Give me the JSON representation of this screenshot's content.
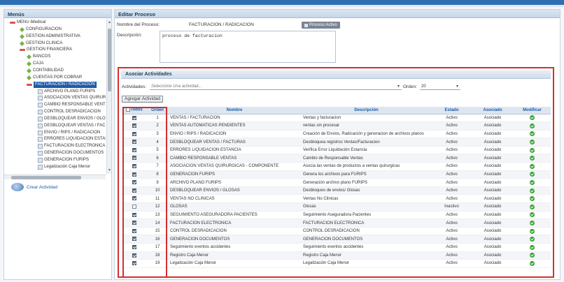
{
  "menu": {
    "title": "Menús",
    "tree": [
      {
        "label": "MENU iMedical",
        "icon": "minus",
        "level": 0
      },
      {
        "label": "CONFIGURACION",
        "icon": "diamond",
        "level": 1
      },
      {
        "label": "GESTION ADMINISTRATIVA",
        "icon": "diamond",
        "level": 1
      },
      {
        "label": "GESTION CLINICA",
        "icon": "diamond",
        "level": 1
      },
      {
        "label": "GESTION FINANCIERA",
        "icon": "minus",
        "level": 1
      },
      {
        "label": "BANCOS",
        "icon": "diamond",
        "level": 2
      },
      {
        "label": "CAJA",
        "icon": "diamond",
        "level": 2
      },
      {
        "label": "CONTABILIDAD",
        "icon": "diamond",
        "level": 2
      },
      {
        "label": "CUENTAS POR COBRAR",
        "icon": "diamond",
        "level": 2
      },
      {
        "label": "FACTURACION / RADICACION",
        "icon": "minus",
        "level": 2,
        "selected": true
      },
      {
        "label": "ARCHIVO PLANO FURIPS",
        "icon": "doc",
        "level": 3
      },
      {
        "label": "ASOCIACION VENTAS QUIRUR",
        "icon": "doc",
        "level": 3
      },
      {
        "label": "CAMBIO RESPONSABLE VENT",
        "icon": "doc",
        "level": 3
      },
      {
        "label": "CONTROL DESRADICACION",
        "icon": "doc",
        "level": 3
      },
      {
        "label": "DESBLOQUEAR ENVIOS / GLO",
        "icon": "doc",
        "level": 3
      },
      {
        "label": "DESBLOQUEAR VENTAS / FAC",
        "icon": "doc",
        "level": 3
      },
      {
        "label": "ENVIO / RIPS / RADICACION",
        "icon": "doc",
        "level": 3
      },
      {
        "label": "ERRORES LIQUIDACION ESTAI",
        "icon": "doc",
        "level": 3
      },
      {
        "label": "FACTURACION ELECTRONICA",
        "icon": "doc",
        "level": 3
      },
      {
        "label": "GENERACION DOCUMENTOS",
        "icon": "doc",
        "level": 3
      },
      {
        "label": "GENERACION FURIPS",
        "icon": "doc",
        "level": 3
      },
      {
        "label": "Legalización Caja Menor",
        "icon": "doc",
        "level": 3
      }
    ],
    "crear_actividad": "Crear Actividad"
  },
  "edit": {
    "title": "Editar Proceso",
    "nombre_label": "Nombre del Proceso:",
    "nombre_value": "FACTURACION / RADICACION",
    "activo_button": "Proceso Activo",
    "descripcion_label": "Descripción:",
    "descripcion_value": "proceso de facturacion"
  },
  "asociar": {
    "title": "Asociar Actividades",
    "actividades_label": "Actividades:",
    "actividades_placeholder": "Seleccione Una actividad...",
    "orden_label": "Orden:",
    "orden_value": "20",
    "agregar_button": "Agregar Actividad",
    "columns": {
      "todos": "Todos",
      "orden": "Orden",
      "nombre": "Nombre",
      "descripcion": "Descripción",
      "estado": "Estado",
      "asociado": "Asociado",
      "modificar": "Modificar"
    },
    "rows": [
      {
        "checked": true,
        "orden": "1",
        "nombre": "VENTAS / FACTURACION",
        "descripcion": "Ventas y facturacion",
        "estado": "Activo",
        "asociado": "Asociado"
      },
      {
        "checked": true,
        "orden": "2",
        "nombre": "VENTAS AUTOMATICAS PENDIENTES",
        "descripcion": "ventas sin procesar",
        "estado": "Activo",
        "asociado": "Asociado"
      },
      {
        "checked": true,
        "orden": "3",
        "nombre": "ENVIO / RIPS / RADICACION",
        "descripcion": "Creación de Envios, Radicación y generacion de archivos planos",
        "estado": "Activo",
        "asociado": "Asociado"
      },
      {
        "checked": true,
        "orden": "4",
        "nombre": "DESBLOQUEAR VENTAS / FACTURAS",
        "descripcion": "Desbloquea registros Ventas/Facturacion",
        "estado": "Activo",
        "asociado": "Asociado"
      },
      {
        "checked": true,
        "orden": "5",
        "nombre": "ERRORES LIQUIDACION ESTANCIA",
        "descripcion": "Verifica Error Liquidación Estancia",
        "estado": "Activo",
        "asociado": "Asociado"
      },
      {
        "checked": true,
        "orden": "6",
        "nombre": "CAMBIO RESPONSABLE VENTAS",
        "descripcion": "Cambio de Responsable Ventas",
        "estado": "Activo",
        "asociado": "Asociado"
      },
      {
        "checked": true,
        "orden": "7",
        "nombre": "ASOCIACION VENTAS QUIRURGICAS - COMPONENTE",
        "descripcion": "Asocia las ventas de productos a ventas quirurgicas",
        "estado": "Activo",
        "asociado": "Asociado"
      },
      {
        "checked": true,
        "orden": "8",
        "nombre": "GENERACION FURIPS",
        "descripcion": "Genera los archivos para FURIPS",
        "estado": "Activo",
        "asociado": "Asociado"
      },
      {
        "checked": true,
        "orden": "9",
        "nombre": "ARCHIVO PLANO FURIPS",
        "descripcion": "Generación archivo plano FURIPS",
        "estado": "Activo",
        "asociado": "Asociado"
      },
      {
        "checked": true,
        "orden": "10",
        "nombre": "DESBLOQUEAR ENVIOS / GLOSAS",
        "descripcion": "Desbloqueo de envios/ Glosas",
        "estado": "Activo",
        "asociado": "Asociado"
      },
      {
        "checked": true,
        "orden": "11",
        "nombre": "VENTAS NO CLINICAS",
        "descripcion": "Ventas No Clinicas",
        "estado": "Activo",
        "asociado": "Asociado"
      },
      {
        "checked": false,
        "orden": "12",
        "nombre": "GLOSAS",
        "descripcion": "Glosas",
        "estado": "Inactivo",
        "asociado": "Asociado"
      },
      {
        "checked": true,
        "orden": "13",
        "nombre": "SEGUIMIENTO ASEGURADORA PACIENTES",
        "descripcion": "Seguimiento Aseguradora Pacientes",
        "estado": "Activo",
        "asociado": "Asociado"
      },
      {
        "checked": true,
        "orden": "14",
        "nombre": "FACTURACION ELECTRONICA",
        "descripcion": "FACTURACION ELECTRONICA",
        "estado": "Activo",
        "asociado": "Asociado"
      },
      {
        "checked": true,
        "orden": "15",
        "nombre": "CONTROL DESRADICACION",
        "descripcion": "CONTROL DESRADICACION",
        "estado": "Activo",
        "asociado": "Asociado"
      },
      {
        "checked": true,
        "orden": "16",
        "nombre": "GENERACION DOCUMENTOS",
        "descripcion": "GENERACION DOCUMENTOS",
        "estado": "Activo",
        "asociado": "Asociado"
      },
      {
        "checked": true,
        "orden": "17",
        "nombre": "Seguimiento eventos accidentes",
        "descripcion": "Seguimiento eventos accidentes",
        "estado": "Activo",
        "asociado": "Asociado"
      },
      {
        "checked": true,
        "orden": "18",
        "nombre": "Registro Caja Menor",
        "descripcion": "Registro Caja Menor",
        "estado": "Activo",
        "asociado": "Asociado"
      },
      {
        "checked": true,
        "orden": "19",
        "nombre": "Legalización Caja Menor",
        "descripcion": "Legalización Caja Menor",
        "estado": "Activo",
        "asociado": "Asociado"
      }
    ],
    "modificar_icon": "check-circle-icon"
  },
  "colors": {
    "header_text": "#1e5aa8",
    "highlight_border": "#d32f2f",
    "ok_green": "#34a234",
    "top_bar": "#2e6fb3"
  }
}
